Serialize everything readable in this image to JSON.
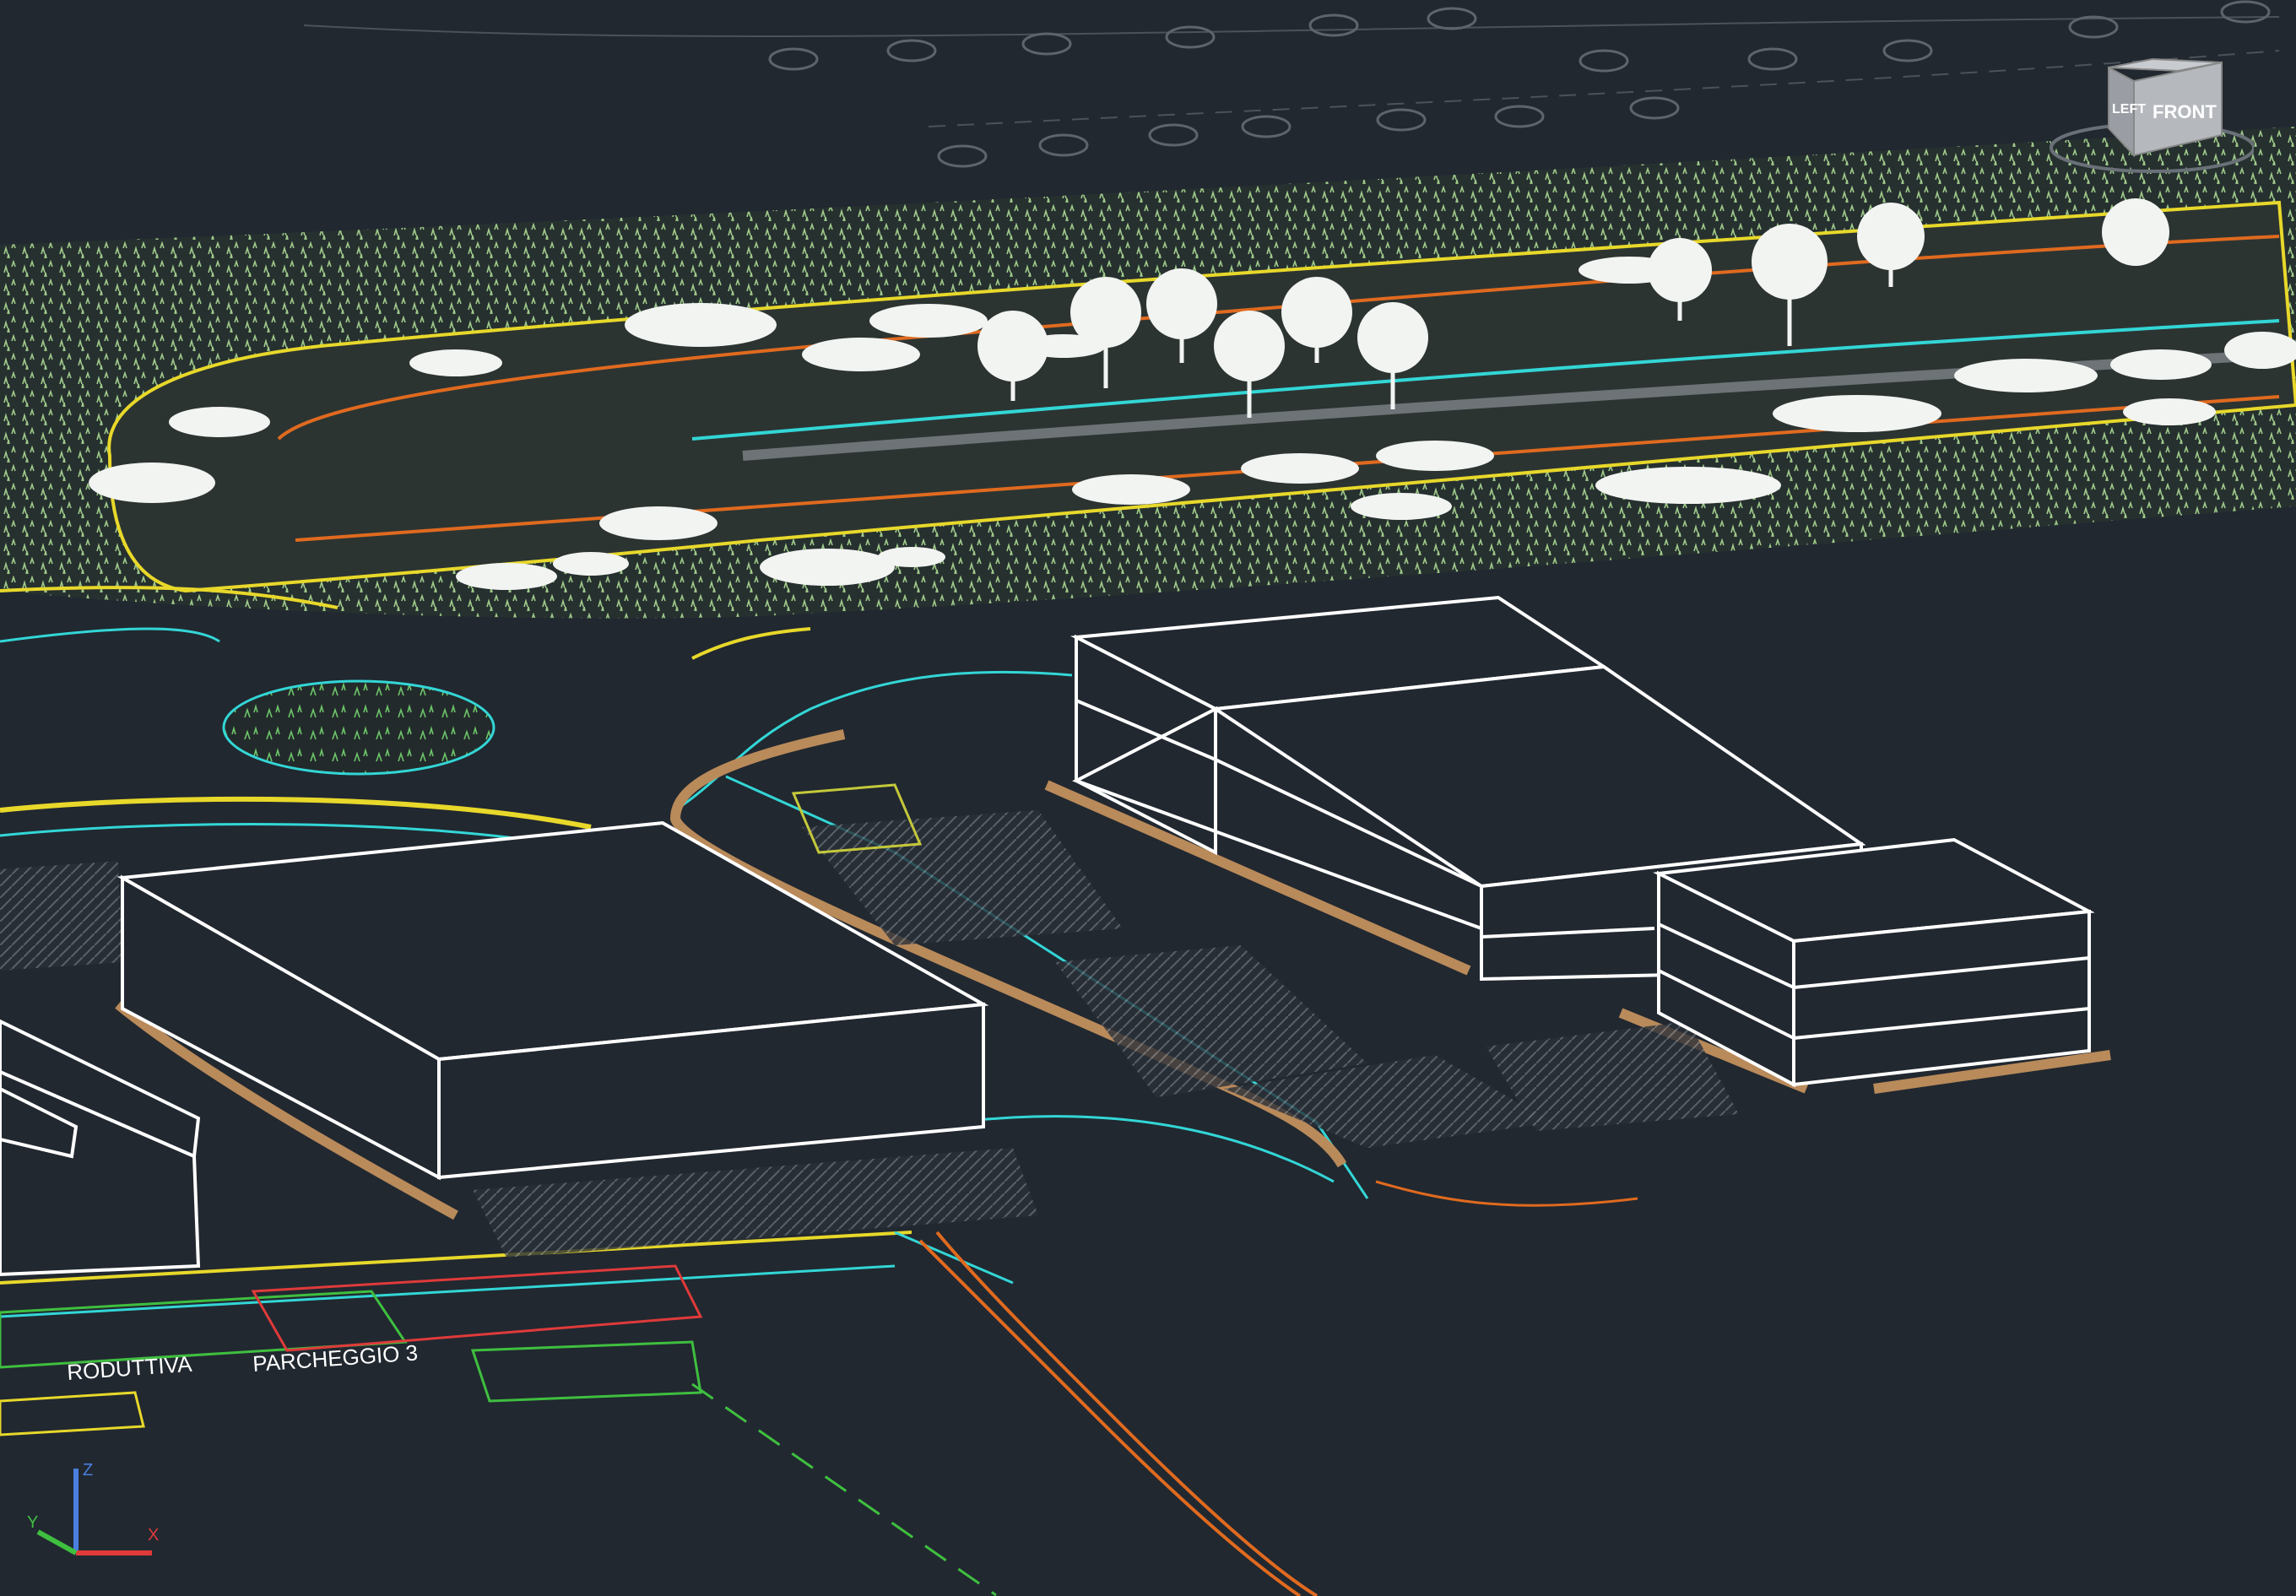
{
  "drawing": {
    "labels": {
      "parking": "PARCHEGGIO 3",
      "zone": "RODUTTIVA"
    }
  },
  "viewcube": {
    "left_face": "LEFT",
    "front_face": "FRONT"
  },
  "ucs": {
    "x_axis": "X",
    "y_axis": "Y",
    "z_axis": "Z"
  },
  "colors": {
    "background": "#212830",
    "building_edge": "#ffffff",
    "road_cyan": "#33d6d6",
    "road_yellow": "#e8d82a",
    "curb_orange": "#e06a1f",
    "vegetation": "#9fc98a",
    "ground_tan": "#b98a5a",
    "grid_grey": "#5e646c",
    "axis_red": "#e03a3a",
    "axis_green": "#3fbf3f",
    "axis_blue": "#4a7fe0"
  }
}
